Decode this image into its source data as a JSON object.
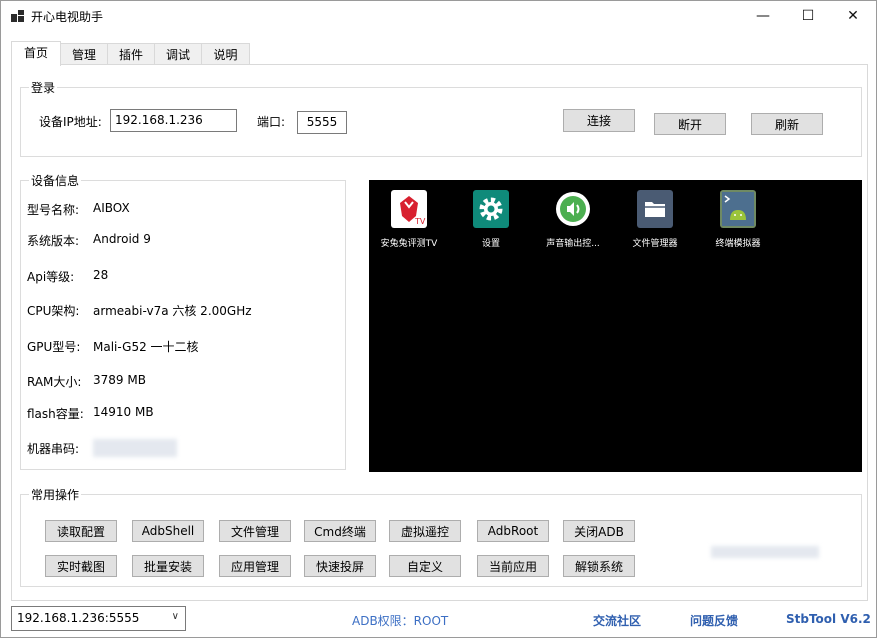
{
  "window": {
    "title": "开心电视助手",
    "minimize_glyph": "—",
    "maximize_glyph": "☐",
    "close_glyph": "✕"
  },
  "tabs": [
    {
      "label": "首页",
      "active": true
    },
    {
      "label": "管理"
    },
    {
      "label": "插件"
    },
    {
      "label": "调试"
    },
    {
      "label": "说明"
    }
  ],
  "login": {
    "title": "登录",
    "ip_label": "设备IP地址:",
    "ip_value": "192.168.1.236",
    "port_label": "端口:",
    "port_value": "5555",
    "connect": "连接",
    "disconnect": "断开",
    "refresh": "刷新"
  },
  "device_info": {
    "title": "设备信息",
    "rows": [
      {
        "label": "型号名称:",
        "value": "AIBOX"
      },
      {
        "label": "系统版本:",
        "value": "Android 9"
      },
      {
        "label": "Api等级:",
        "value": "28"
      },
      {
        "label": "CPU架构:",
        "value": "armeabi-v7a 六核 2.00GHz"
      },
      {
        "label": "GPU型号:",
        "value": "Mali-G52 一十二核"
      },
      {
        "label": "RAM大小:",
        "value": "3789 MB"
      },
      {
        "label": "flash容量:",
        "value": "14910 MB"
      },
      {
        "label": "机器串码:",
        "value": ""
      }
    ]
  },
  "screen_apps": [
    {
      "name": "安兔兔评测TV",
      "icon": "antutu-icon",
      "color": "#ffffff"
    },
    {
      "name": "设置",
      "icon": "settings-icon",
      "color": "#0f8a7a"
    },
    {
      "name": "声音输出控...",
      "icon": "sound-icon",
      "color": "#ffffff"
    },
    {
      "name": "文件管理器",
      "icon": "folder-icon",
      "color": "#4a5b73"
    },
    {
      "name": "终端模拟器",
      "icon": "terminal-icon",
      "color": "#6f8a63"
    }
  ],
  "operations": {
    "title": "常用操作",
    "row1": [
      "读取配置",
      "AdbShell",
      "文件管理",
      "Cmd终端",
      "虚拟遥控",
      "AdbRoot",
      "关闭ADB"
    ],
    "row2": [
      "实时截图",
      "批量安装",
      "应用管理",
      "快速投屏",
      "自定义",
      "当前应用",
      "解锁系统"
    ]
  },
  "statusbar": {
    "device": "192.168.1.236:5555",
    "adb": "ADB权限：ROOT",
    "community": "交流社区",
    "feedback": "问题反馈",
    "version": "StbTool V6.2"
  }
}
